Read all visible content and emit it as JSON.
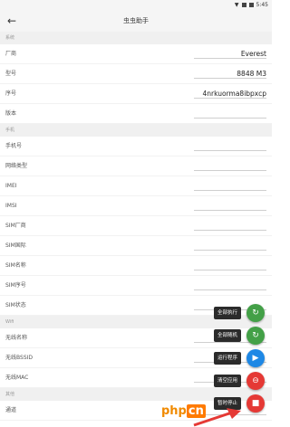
{
  "status_bar": {
    "time": "5:45"
  },
  "app_bar": {
    "title": "虫虫助手",
    "back_icon": "arrow-left-icon"
  },
  "sections": [
    {
      "header": "系统",
      "rows": [
        {
          "label": "厂商",
          "value": "Everest"
        },
        {
          "label": "型号",
          "value": "8848 M3"
        },
        {
          "label": "序号",
          "value": "4nrkuorma8ibpxcp"
        },
        {
          "label": "版本",
          "value": ""
        }
      ]
    },
    {
      "header": "手机",
      "rows": [
        {
          "label": "手机号",
          "value": ""
        },
        {
          "label": "网络类型",
          "value": ""
        },
        {
          "label": "IMEI",
          "value": ""
        },
        {
          "label": "IMSI",
          "value": ""
        },
        {
          "label": "SIM厂商",
          "value": ""
        },
        {
          "label": "SIM国际",
          "value": ""
        },
        {
          "label": "SIM名称",
          "value": ""
        },
        {
          "label": "SIM序号",
          "value": ""
        },
        {
          "label": "SIM状态",
          "value": ""
        }
      ]
    },
    {
      "header": "Wifi",
      "rows": [
        {
          "label": "无线名称",
          "value": ""
        },
        {
          "label": "无线BSSID",
          "value": ""
        },
        {
          "label": "无线MAC",
          "value": ""
        }
      ]
    },
    {
      "header": "其他",
      "rows": [
        {
          "label": "通道",
          "value": ""
        }
      ]
    }
  ],
  "fab_menu": {
    "items": [
      {
        "label": "全部执行",
        "icon": "refresh-icon",
        "color": "#43a047"
      },
      {
        "label": "全部随机",
        "icon": "refresh-icon",
        "color": "#43a047"
      },
      {
        "label": "运行程序",
        "icon": "play-icon",
        "color": "#1e88e5"
      },
      {
        "label": "清空应用",
        "icon": "minus-circle-icon",
        "color": "#e53935"
      },
      {
        "label": "暂时停止",
        "icon": "stop-icon",
        "color": "#e53935"
      }
    ]
  },
  "watermark": {
    "text": "php",
    "text2": "cn"
  },
  "colors": {
    "app_bar": "#f5f5f5",
    "section_bg": "#f0f0f0",
    "green": "#43a047",
    "blue": "#1e88e5",
    "red": "#e53935"
  }
}
